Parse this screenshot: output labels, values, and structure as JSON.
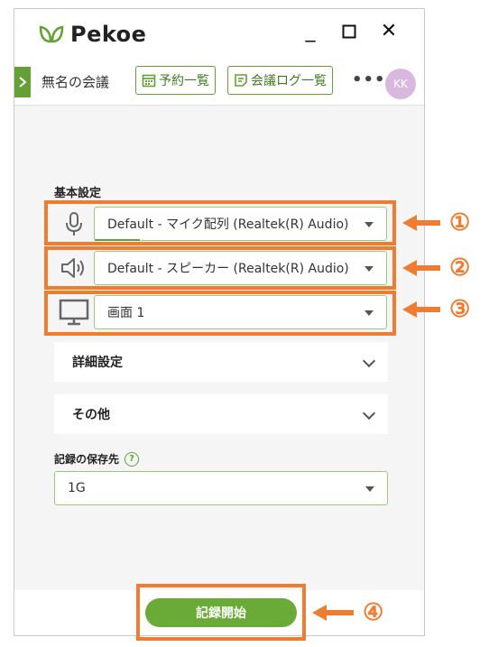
{
  "app": {
    "name": "Pekoe"
  },
  "window_controls": {
    "minimize": "_",
    "maximize": "☐",
    "close": "✕"
  },
  "toolbar": {
    "meeting_title": "無名の会議",
    "reservations_label": "予約一覧",
    "meeting_log_label": "会議ログ一覧",
    "more_label": "•••",
    "avatar_initials": "KK"
  },
  "settings": {
    "section_label": "基本設定",
    "microphone": {
      "value": "Default - マイク配列 (Realtek(R) Audio)",
      "icon": "microphone-icon"
    },
    "speaker": {
      "value": "Default - スピーカー (Realtek(R) Audio)",
      "icon": "speaker-icon"
    },
    "screen": {
      "value": "画面 1",
      "icon": "monitor-icon"
    },
    "advanced_label": "詳細設定",
    "other_label": "その他",
    "save_location_label": "記録の保存先",
    "save_location_help": "?",
    "save_location_value": "1G"
  },
  "footer": {
    "start_recording_label": "記録開始"
  },
  "annotations": {
    "markers": [
      "①",
      "②",
      "③",
      "④"
    ],
    "color": "#ef7d31"
  },
  "colors": {
    "accent": "#63a036",
    "highlight": "#ef7d31"
  }
}
